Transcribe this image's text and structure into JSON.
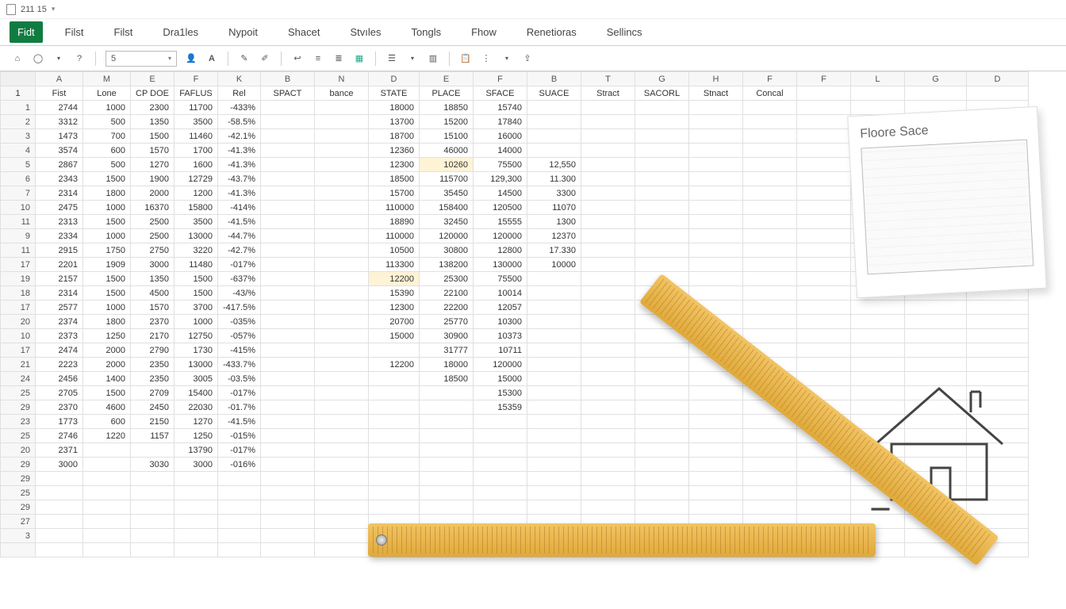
{
  "title": "211 15",
  "menu": [
    "Fidt",
    "Filst",
    "Filst",
    "Dra1les",
    "Nypoit",
    "Shacet",
    "Stvıles",
    "Tongls",
    "Fhow",
    "Renetioras",
    "Sellincs"
  ],
  "menu_active_index": 0,
  "toolbar": {
    "font_value": "5"
  },
  "columns": [
    "A",
    "M",
    "E",
    "F",
    "K",
    "B",
    "N",
    "D",
    "E",
    "F",
    "B",
    "T",
    "G",
    "H",
    "F",
    "F",
    "L",
    "G",
    "D"
  ],
  "headers_row": [
    "Fist",
    "Lone",
    "CP DOE",
    "FAFLUS",
    "Rel",
    "SPACT",
    "bance",
    "STATE",
    "PLACE",
    "SFACE",
    "SUACE",
    "Stract",
    "SACORL",
    "Stnact",
    "Concal",
    "",
    "",
    "",
    ""
  ],
  "row_numbers": [
    "1",
    "1",
    "2",
    "3",
    "4",
    "5",
    "6",
    "7",
    "10",
    "11",
    "9",
    "11",
    "17",
    "19",
    "18",
    "17",
    "20",
    "10",
    "17",
    "21",
    "24",
    "25",
    "29",
    "23",
    "25",
    "20",
    "29",
    "29",
    "25",
    "29",
    "27",
    "3"
  ],
  "rows": [
    [
      "2744",
      "1000",
      "2300",
      "11700",
      "-433%",
      "",
      "",
      "18000",
      "18850",
      "15740",
      "",
      "",
      "",
      "",
      "",
      "",
      "",
      "",
      ""
    ],
    [
      "3312",
      "500",
      "1350",
      "3500",
      "-58.5%",
      "",
      "",
      "13700",
      "15200",
      "17840",
      "",
      "",
      "",
      "",
      "",
      "",
      "",
      "",
      ""
    ],
    [
      "1473",
      "700",
      "1500",
      "11460",
      "-42.1%",
      "",
      "",
      "18700",
      "15100",
      "16000",
      "",
      "",
      "",
      "",
      "",
      "",
      "",
      "",
      ""
    ],
    [
      "3574",
      "600",
      "1570",
      "1700",
      "-41.3%",
      "",
      "",
      "12360",
      "46000",
      "14000",
      "",
      "",
      "",
      "",
      "",
      "",
      "",
      "",
      ""
    ],
    [
      "2867",
      "500",
      "1270",
      "1600",
      "-41.3%",
      "",
      "",
      "12300",
      "10260",
      "75500",
      "12,550",
      "",
      "",
      "",
      "",
      "",
      "",
      "",
      ""
    ],
    [
      "2343",
      "1500",
      "1900",
      "12729",
      "-43.7%",
      "",
      "",
      "18500",
      "115700",
      "129,300",
      "11.300",
      "",
      "",
      "",
      "",
      "",
      "",
      "",
      ""
    ],
    [
      "2314",
      "1800",
      "2000",
      "1200",
      "-41.3%",
      "",
      "",
      "15700",
      "35450",
      "14500",
      "3300",
      "",
      "",
      "",
      "",
      "",
      "",
      "",
      ""
    ],
    [
      "2475",
      "1000",
      "16370",
      "15800",
      "-414%",
      "",
      "",
      "110000",
      "158400",
      "120500",
      "11070",
      "",
      "",
      "",
      "",
      "",
      "",
      "",
      ""
    ],
    [
      "2313",
      "1500",
      "2500",
      "3500",
      "-41.5%",
      "",
      "",
      "18890",
      "32450",
      "15555",
      "1300",
      "",
      "",
      "",
      "",
      "",
      "",
      "",
      ""
    ],
    [
      "2334",
      "1000",
      "2500",
      "13000",
      "-44.7%",
      "",
      "",
      "110000",
      "120000",
      "120000",
      "12370",
      "",
      "",
      "",
      "",
      "",
      "",
      "",
      ""
    ],
    [
      "2915",
      "1750",
      "2750",
      "3220",
      "-42.7%",
      "",
      "",
      "10500",
      "30800",
      "12800",
      "17.330",
      "",
      "",
      "",
      "",
      "",
      "",
      "",
      ""
    ],
    [
      "2201",
      "1909",
      "3000",
      "11480",
      "-017%",
      "",
      "",
      "113300",
      "138200",
      "130000",
      "10000",
      "",
      "",
      "",
      "",
      "",
      "",
      "",
      ""
    ],
    [
      "2157",
      "1500",
      "1350",
      "1500",
      "-637%",
      "",
      "",
      "12200",
      "25300",
      "75500",
      "",
      "",
      "",
      "",
      "",
      "",
      "",
      "",
      ""
    ],
    [
      "2314",
      "1500",
      "4500",
      "1500",
      "-43/%",
      "",
      "",
      "15390",
      "22100",
      "10014",
      "",
      "",
      "",
      "",
      "",
      "",
      "",
      "",
      ""
    ],
    [
      "2577",
      "1000",
      "1570",
      "3700",
      "-417.5%",
      "",
      "",
      "12300",
      "22200",
      "12057",
      "",
      "",
      "",
      "",
      "",
      "",
      "",
      "",
      ""
    ],
    [
      "2374",
      "1800",
      "2370",
      "1000",
      "-035%",
      "",
      "",
      "20700",
      "25770",
      "10300",
      "",
      "",
      "",
      "",
      "",
      "",
      "",
      "",
      ""
    ],
    [
      "2373",
      "1250",
      "2170",
      "12750",
      "-057%",
      "",
      "",
      "15000",
      "30900",
      "10373",
      "",
      "",
      "",
      "",
      "",
      "",
      "",
      "",
      ""
    ],
    [
      "2474",
      "2000",
      "2790",
      "1730",
      "-415%",
      "",
      "",
      "",
      "31777",
      "10711",
      "",
      "",
      "",
      "",
      "",
      "",
      "",
      "",
      ""
    ],
    [
      "2223",
      "2000",
      "2350",
      "13000",
      "-433.7%",
      "",
      "",
      "12200",
      "18000",
      "120000",
      "",
      "",
      "",
      "",
      "",
      "",
      "",
      "",
      ""
    ],
    [
      "2456",
      "1400",
      "2350",
      "3005",
      "-03.5%",
      "",
      "",
      "",
      "18500",
      "15000",
      "",
      "",
      "",
      "",
      "",
      "",
      "",
      "",
      ""
    ],
    [
      "2705",
      "1500",
      "2709",
      "15400",
      "-017%",
      "",
      "",
      "",
      "",
      "15300",
      "",
      "",
      "",
      "",
      "",
      "",
      "",
      "",
      ""
    ],
    [
      "2370",
      "4600",
      "2450",
      "22030",
      "-01.7%",
      "",
      "",
      "",
      "",
      "15359",
      "",
      "",
      "",
      "",
      "",
      "",
      "",
      "",
      ""
    ],
    [
      "1773",
      "600",
      "2150",
      "1270",
      "-41.5%",
      "",
      "",
      "",
      "",
      "",
      "",
      "",
      "",
      "",
      "",
      "",
      "",
      "",
      ""
    ],
    [
      "2746",
      "1220",
      "1157",
      "1250",
      "-015%",
      "",
      "",
      "",
      "",
      "",
      "",
      "",
      "",
      "",
      "",
      "",
      "",
      "",
      ""
    ],
    [
      "2371",
      "",
      "",
      "13790",
      "-017%",
      "",
      "",
      "",
      "",
      "",
      "",
      "",
      "",
      "",
      "",
      "",
      "",
      "",
      ""
    ],
    [
      "3000",
      "",
      "3030",
      "3000",
      "-016%",
      "",
      "",
      "",
      "",
      "",
      "",
      "",
      "",
      "",
      "",
      "",
      "",
      "",
      ""
    ],
    [
      "",
      "",
      "",
      "",
      "",
      "",
      "",
      "",
      "",
      "",
      "",
      "",
      "",
      "",
      "",
      "",
      "",
      "",
      ""
    ],
    [
      "",
      "",
      "",
      "",
      "",
      "",
      "",
      "",
      "",
      "",
      "",
      "",
      "",
      "",
      "",
      "",
      "",
      "",
      ""
    ],
    [
      "",
      "",
      "",
      "",
      "",
      "",
      "",
      "",
      "",
      "",
      "",
      "",
      "",
      "",
      "",
      "",
      "",
      "",
      ""
    ],
    [
      "",
      "",
      "",
      "",
      "",
      "",
      "",
      "",
      "",
      "",
      "",
      "",
      "",
      "",
      "",
      "",
      "",
      "",
      ""
    ],
    [
      "",
      "",
      "",
      "",
      "",
      "",
      "",
      "",
      "",
      "",
      "",
      "",
      "",
      "",
      "",
      "",
      "",
      "",
      ""
    ],
    [
      "",
      "",
      "",
      "",
      "",
      "",
      "",
      "",
      "",
      "",
      "",
      "",
      "",
      "",
      "",
      "",
      "",
      "",
      ""
    ]
  ],
  "highlights": [
    [
      4,
      8
    ],
    [
      12,
      7
    ]
  ],
  "note_title": "Floore Sace",
  "chart_data": {
    "type": "table",
    "title": "",
    "columns": [
      "Fist",
      "Lone",
      "CP DOE",
      "FAFLUS",
      "Rel",
      "SPACT",
      "bance",
      "STATE",
      "PLACE",
      "SFACE",
      "SUACE",
      "Stract",
      "SACORL",
      "Stnact",
      "Concal"
    ],
    "rows_ref": "rows"
  }
}
